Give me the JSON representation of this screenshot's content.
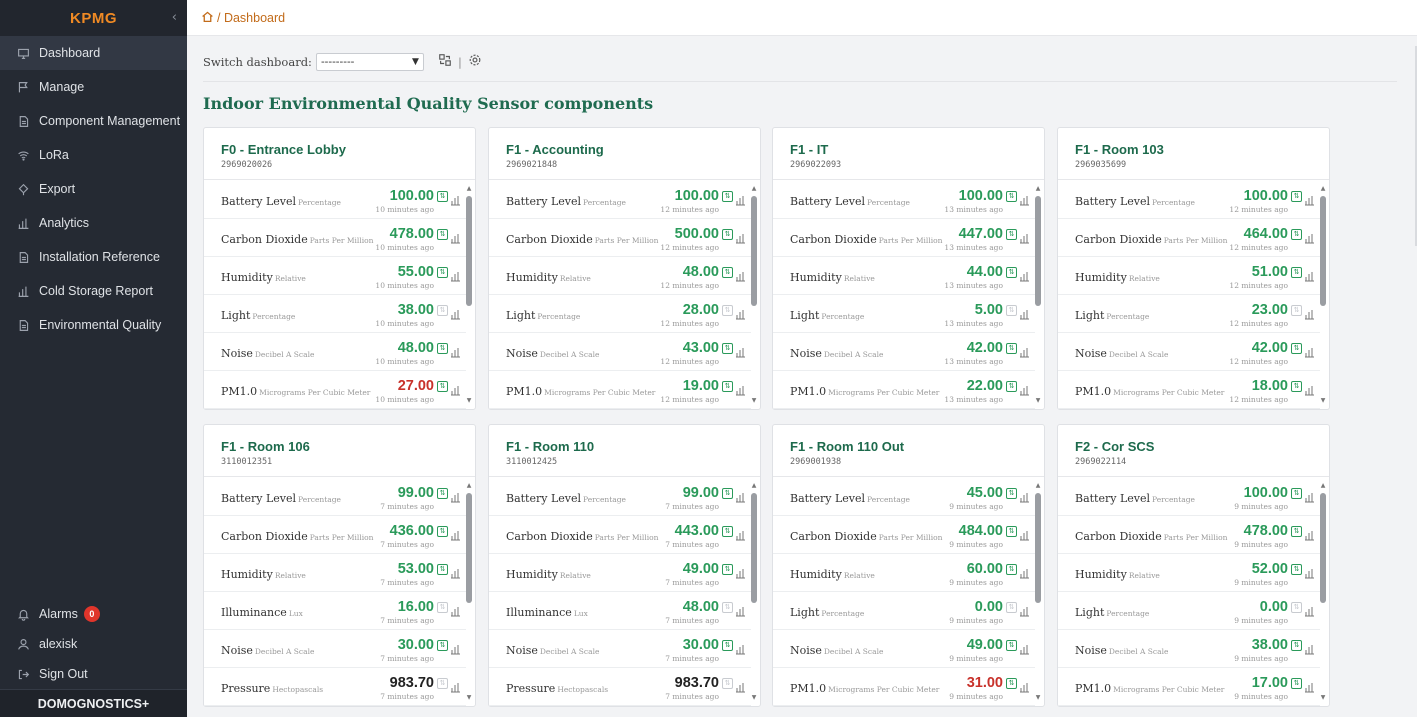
{
  "sidebar": {
    "brand": "KPMG",
    "collapse_glyph": "‹",
    "items": [
      {
        "label": "Dashboard",
        "icon": "monitor-icon",
        "active": true
      },
      {
        "label": "Manage",
        "icon": "flag-icon"
      },
      {
        "label": "Component Management",
        "icon": "file-icon"
      },
      {
        "label": "LoRa",
        "icon": "wifi-icon"
      },
      {
        "label": "Export",
        "icon": "export-icon"
      },
      {
        "label": "Analytics",
        "icon": "bar-chart-icon"
      },
      {
        "label": "Installation Reference",
        "icon": "file-icon"
      },
      {
        "label": "Cold Storage Report",
        "icon": "bar-chart-icon"
      },
      {
        "label": "Environmental Quality",
        "icon": "file-icon"
      }
    ],
    "bottom": {
      "alarms_label": "Alarms",
      "alarms_count": "0",
      "user_label": "alexisk",
      "signout_label": "Sign Out"
    },
    "footer": "DOMOGNOSTICS+"
  },
  "topbar": {
    "breadcrumb": "/ Dashboard"
  },
  "controls": {
    "switch_label": "Switch dashboard:",
    "selected": "---------",
    "separator": "|"
  },
  "section_title": "Indoor Environmental Quality Sensor components",
  "colors": {
    "accent_green": "#1d6a4c",
    "value_green": "#2a9a5a",
    "alert_red": "#c8322b",
    "brand_orange": "#f08a24"
  },
  "cards": [
    {
      "title": "F0 - Entrance Lobby",
      "id": "2969020026",
      "rows": [
        {
          "label": "Battery Level",
          "unit": "Percentage",
          "value": "100.00",
          "ago": "10 minutes ago"
        },
        {
          "label": "Carbon Dioxide",
          "unit": "Parts Per Million",
          "value": "478.00",
          "ago": "10 minutes ago"
        },
        {
          "label": "Humidity",
          "unit": "Relative",
          "value": "55.00",
          "ago": "10 minutes ago"
        },
        {
          "label": "Light",
          "unit": "Percentage",
          "value": "38.00",
          "ago": "10 minutes ago",
          "off": true
        },
        {
          "label": "Noise",
          "unit": "Decibel A Scale",
          "value": "48.00",
          "ago": "10 minutes ago"
        },
        {
          "label": "PM1.0",
          "unit": "Micrograms Per Cubic Meter",
          "value": "27.00",
          "ago": "10 minutes ago",
          "alert": true
        }
      ]
    },
    {
      "title": "F1 - Accounting",
      "id": "2969021848",
      "rows": [
        {
          "label": "Battery Level",
          "unit": "Percentage",
          "value": "100.00",
          "ago": "12 minutes ago"
        },
        {
          "label": "Carbon Dioxide",
          "unit": "Parts Per Million",
          "value": "500.00",
          "ago": "12 minutes ago"
        },
        {
          "label": "Humidity",
          "unit": "Relative",
          "value": "48.00",
          "ago": "12 minutes ago"
        },
        {
          "label": "Light",
          "unit": "Percentage",
          "value": "28.00",
          "ago": "12 minutes ago",
          "off": true
        },
        {
          "label": "Noise",
          "unit": "Decibel A Scale",
          "value": "43.00",
          "ago": "12 minutes ago"
        },
        {
          "label": "PM1.0",
          "unit": "Micrograms Per Cubic Meter",
          "value": "19.00",
          "ago": "12 minutes ago"
        }
      ]
    },
    {
      "title": "F1 - IT",
      "id": "2969022093",
      "rows": [
        {
          "label": "Battery Level",
          "unit": "Percentage",
          "value": "100.00",
          "ago": "13 minutes ago"
        },
        {
          "label": "Carbon Dioxide",
          "unit": "Parts Per Million",
          "value": "447.00",
          "ago": "13 minutes ago"
        },
        {
          "label": "Humidity",
          "unit": "Relative",
          "value": "44.00",
          "ago": "13 minutes ago"
        },
        {
          "label": "Light",
          "unit": "Percentage",
          "value": "5.00",
          "ago": "13 minutes ago",
          "off": true
        },
        {
          "label": "Noise",
          "unit": "Decibel A Scale",
          "value": "42.00",
          "ago": "13 minutes ago"
        },
        {
          "label": "PM1.0",
          "unit": "Micrograms Per Cubic Meter",
          "value": "22.00",
          "ago": "13 minutes ago"
        }
      ]
    },
    {
      "title": "F1 - Room 103",
      "id": "2969035699",
      "rows": [
        {
          "label": "Battery Level",
          "unit": "Percentage",
          "value": "100.00",
          "ago": "12 minutes ago"
        },
        {
          "label": "Carbon Dioxide",
          "unit": "Parts Per Million",
          "value": "464.00",
          "ago": "12 minutes ago"
        },
        {
          "label": "Humidity",
          "unit": "Relative",
          "value": "51.00",
          "ago": "12 minutes ago"
        },
        {
          "label": "Light",
          "unit": "Percentage",
          "value": "23.00",
          "ago": "12 minutes ago",
          "off": true
        },
        {
          "label": "Noise",
          "unit": "Decibel A Scale",
          "value": "42.00",
          "ago": "12 minutes ago"
        },
        {
          "label": "PM1.0",
          "unit": "Micrograms Per Cubic Meter",
          "value": "18.00",
          "ago": "12 minutes ago"
        }
      ]
    },
    {
      "title": "F1 - Room 106",
      "id": "3110012351",
      "rows": [
        {
          "label": "Battery Level",
          "unit": "Percentage",
          "value": "99.00",
          "ago": "7 minutes ago"
        },
        {
          "label": "Carbon Dioxide",
          "unit": "Parts Per Million",
          "value": "436.00",
          "ago": "7 minutes ago"
        },
        {
          "label": "Humidity",
          "unit": "Relative",
          "value": "53.00",
          "ago": "7 minutes ago"
        },
        {
          "label": "Illuminance",
          "unit": "Lux",
          "value": "16.00",
          "ago": "7 minutes ago",
          "off": true
        },
        {
          "label": "Noise",
          "unit": "Decibel A Scale",
          "value": "30.00",
          "ago": "7 minutes ago"
        },
        {
          "label": "Pressure",
          "unit": "Hectopascals",
          "value": "983.70",
          "ago": "7 minutes ago",
          "dark": true,
          "off": true
        }
      ]
    },
    {
      "title": "F1 - Room 110",
      "id": "3110012425",
      "rows": [
        {
          "label": "Battery Level",
          "unit": "Percentage",
          "value": "99.00",
          "ago": "7 minutes ago"
        },
        {
          "label": "Carbon Dioxide",
          "unit": "Parts Per Million",
          "value": "443.00",
          "ago": "7 minutes ago"
        },
        {
          "label": "Humidity",
          "unit": "Relative",
          "value": "49.00",
          "ago": "7 minutes ago"
        },
        {
          "label": "Illuminance",
          "unit": "Lux",
          "value": "48.00",
          "ago": "7 minutes ago",
          "off": true
        },
        {
          "label": "Noise",
          "unit": "Decibel A Scale",
          "value": "30.00",
          "ago": "7 minutes ago"
        },
        {
          "label": "Pressure",
          "unit": "Hectopascals",
          "value": "983.70",
          "ago": "7 minutes ago",
          "dark": true,
          "off": true
        }
      ]
    },
    {
      "title": "F1 - Room 110 Out",
      "id": "2969001938",
      "rows": [
        {
          "label": "Battery Level",
          "unit": "Percentage",
          "value": "45.00",
          "ago": "9 minutes ago"
        },
        {
          "label": "Carbon Dioxide",
          "unit": "Parts Per Million",
          "value": "484.00",
          "ago": "9 minutes ago"
        },
        {
          "label": "Humidity",
          "unit": "Relative",
          "value": "60.00",
          "ago": "9 minutes ago"
        },
        {
          "label": "Light",
          "unit": "Percentage",
          "value": "0.00",
          "ago": "9 minutes ago",
          "off": true
        },
        {
          "label": "Noise",
          "unit": "Decibel A Scale",
          "value": "49.00",
          "ago": "9 minutes ago"
        },
        {
          "label": "PM1.0",
          "unit": "Micrograms Per Cubic Meter",
          "value": "31.00",
          "ago": "9 minutes ago",
          "alert": true
        }
      ]
    },
    {
      "title": "F2 - Cor SCS",
      "id": "2969022114",
      "rows": [
        {
          "label": "Battery Level",
          "unit": "Percentage",
          "value": "100.00",
          "ago": "9 minutes ago"
        },
        {
          "label": "Carbon Dioxide",
          "unit": "Parts Per Million",
          "value": "478.00",
          "ago": "9 minutes ago"
        },
        {
          "label": "Humidity",
          "unit": "Relative",
          "value": "52.00",
          "ago": "9 minutes ago"
        },
        {
          "label": "Light",
          "unit": "Percentage",
          "value": "0.00",
          "ago": "9 minutes ago",
          "off": true
        },
        {
          "label": "Noise",
          "unit": "Decibel A Scale",
          "value": "38.00",
          "ago": "9 minutes ago"
        },
        {
          "label": "PM1.0",
          "unit": "Micrograms Per Cubic Meter",
          "value": "17.00",
          "ago": "9 minutes ago"
        }
      ]
    }
  ]
}
